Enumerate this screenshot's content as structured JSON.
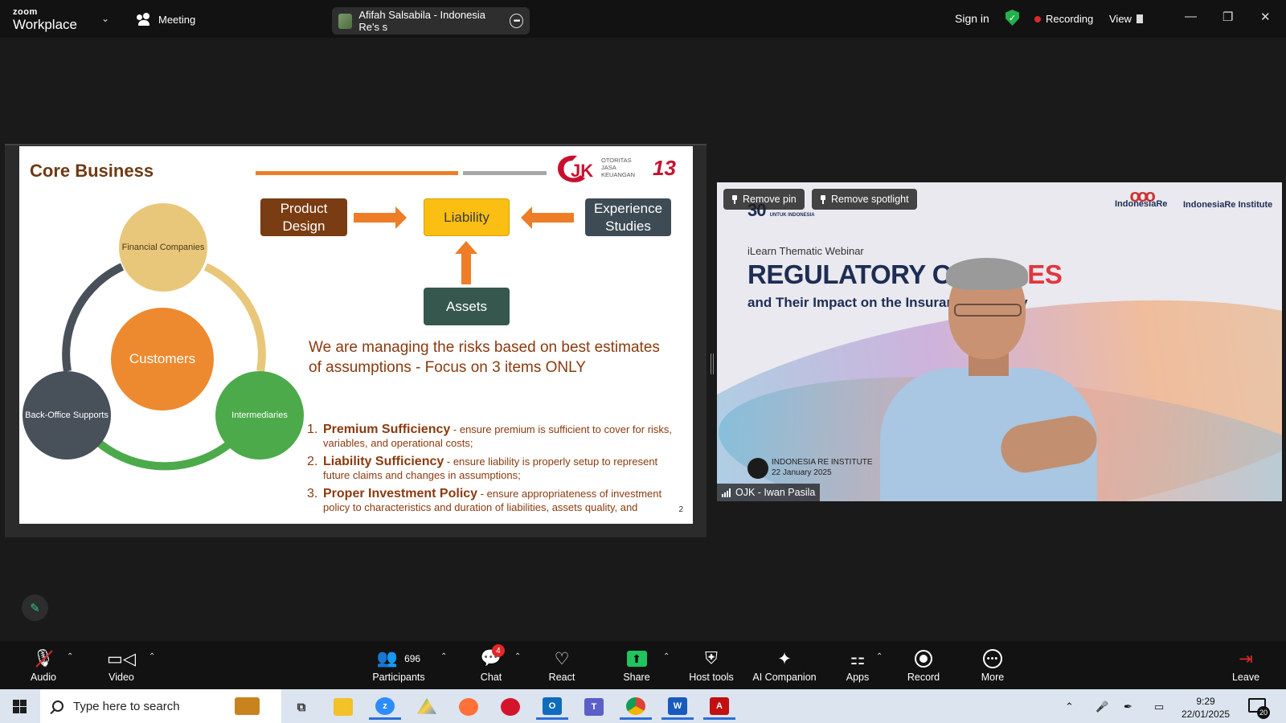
{
  "topbar": {
    "logo_line1": "zoom",
    "logo_line2": "Workplace",
    "meeting_label": "Meeting",
    "speaker_label": "Afifah Salsabila - Indonesia Re's s",
    "signin": "Sign in",
    "recording": "Recording",
    "view": "View"
  },
  "slide": {
    "title": "Core Business",
    "logo_text": "OTORITAS\nJASA\nKEUANGAN",
    "logo_mark": "OJK",
    "anniversary": "13",
    "flow": {
      "product_design": "Product Design",
      "liability": "Liability",
      "experience_studies": "Experience Studies",
      "assets": "Assets"
    },
    "circles": {
      "financial": "Financial Companies",
      "customers": "Customers",
      "back_office": "Back-Office Supports",
      "intermediaries": "Intermediaries"
    },
    "heading": "We are managing the risks based on best estimates of assumptions - Focus on 3 items ONLY",
    "items": [
      {
        "num": "1.",
        "title": "Premium Sufficiency",
        "desc": " - ensure premium is sufficient to cover for risks, variables, and operational costs;"
      },
      {
        "num": "2.",
        "title": "Liability Sufficiency",
        "desc": " - ensure liability is properly setup to represent future claims and changes in assumptions;"
      },
      {
        "num": "3.",
        "title": "Proper Investment Policy",
        "desc": " - ensure appropriateness of investment policy to characteristics and duration of liabilities, assets quality, and"
      }
    ],
    "page_number": "2"
  },
  "video": {
    "remove_pin": "Remove pin",
    "remove_spotlight": "Remove spotlight",
    "brand": "30",
    "brand_small": "UNTUK\nINDONESIA",
    "subtitle": "iLearn Thematic Webinar",
    "title_dark": "REGULATORY C",
    "title_red": "HANGES",
    "title2": "and Their Impact on the Insurance Industry",
    "institute": "INDONESIA RE INSTITUTE",
    "date": "22 January 2025",
    "logo1": "IndonesiaRe",
    "logo2": "IndonesiaRe Institute",
    "participant_name": "OJK - Iwan Pasila"
  },
  "toolbar": {
    "audio": "Audio",
    "video": "Video",
    "participants": "Participants",
    "participant_count": "696",
    "chat": "Chat",
    "chat_badge": "4",
    "react": "React",
    "share": "Share",
    "host_tools": "Host tools",
    "ai_companion": "AI Companion",
    "apps": "Apps",
    "record": "Record",
    "more": "More",
    "leave": "Leave"
  },
  "taskbar": {
    "search_placeholder": "Type here to search",
    "time": "9:29",
    "date": "22/01/2025",
    "notification_count": "20"
  },
  "colors": {
    "accent_green": "#1fc45f",
    "recording_red": "#e02828",
    "slide_brown": "#8b3a0e",
    "slide_orange": "#ee7d27"
  }
}
